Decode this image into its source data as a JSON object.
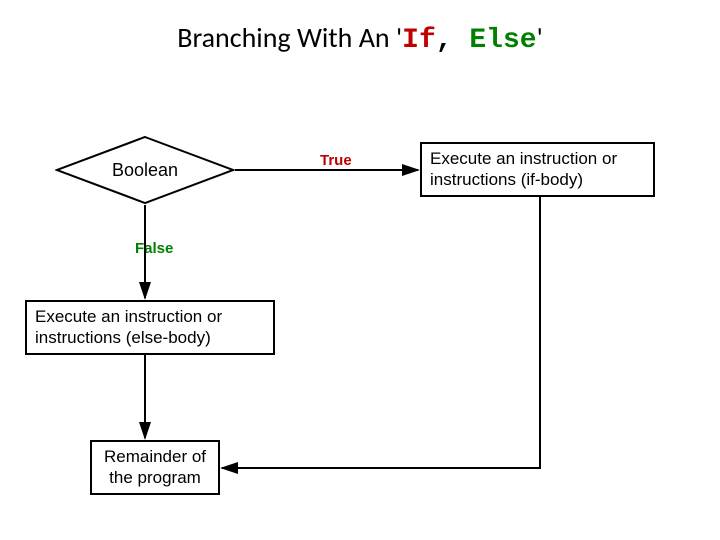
{
  "title": {
    "prefix": "Branching With An '",
    "if": "If",
    "comma": ", ",
    "else": "Else",
    "suffix": "'"
  },
  "nodes": {
    "decision": "Boolean",
    "if_body": "Execute an instruction or instructions (if-body)",
    "else_body": "Execute an instruction or instructions (else-body)",
    "remainder": "Remainder of the program"
  },
  "edges": {
    "true_label": "True",
    "false_label": "False"
  },
  "colors": {
    "if": "#c00000",
    "else": "#008000",
    "stroke": "#000000"
  },
  "chart_data": {
    "type": "flowchart",
    "nodes": [
      {
        "id": "decision",
        "shape": "diamond",
        "label": "Boolean"
      },
      {
        "id": "if_body",
        "shape": "rect",
        "label": "Execute an instruction or instructions (if-body)"
      },
      {
        "id": "else_body",
        "shape": "rect",
        "label": "Execute an instruction or instructions (else-body)"
      },
      {
        "id": "remainder",
        "shape": "rect",
        "label": "Remainder of the program"
      }
    ],
    "edges": [
      {
        "from": "decision",
        "to": "if_body",
        "label": "True"
      },
      {
        "from": "decision",
        "to": "else_body",
        "label": "False"
      },
      {
        "from": "if_body",
        "to": "remainder",
        "label": ""
      },
      {
        "from": "else_body",
        "to": "remainder",
        "label": ""
      }
    ]
  }
}
